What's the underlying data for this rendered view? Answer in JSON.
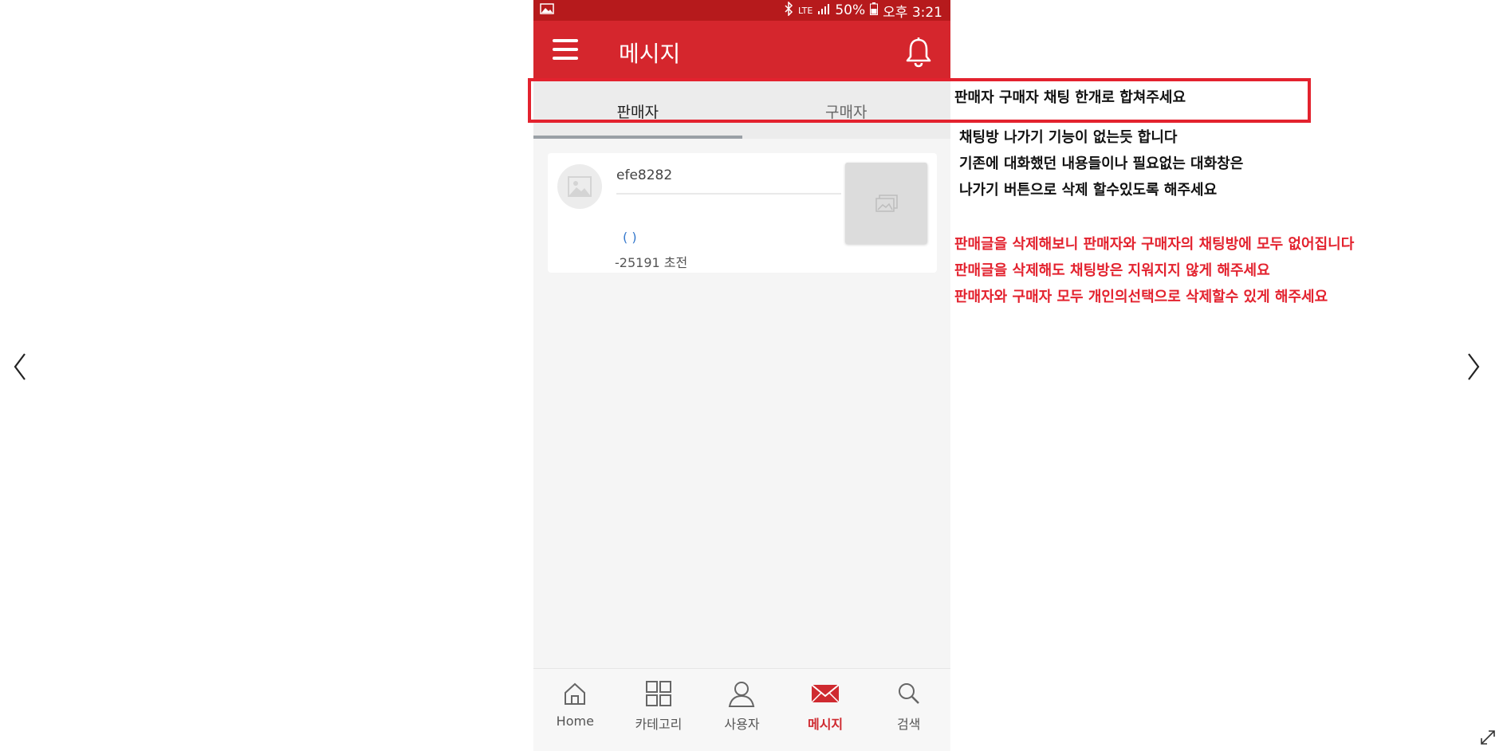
{
  "status_bar": {
    "network": "LTE",
    "battery": "50%",
    "time": "오후 3:21"
  },
  "app_bar": {
    "title": "메시지",
    "menu_icon": "hamburger-menu-icon",
    "notification_icon": "bell-icon"
  },
  "tabs": [
    {
      "label": "판매자",
      "active": true
    },
    {
      "label": "구매자",
      "active": false
    }
  ],
  "chats": [
    {
      "name": "efe8282",
      "preview": "( )",
      "time": "-25191 초전"
    }
  ],
  "bottom_nav": [
    {
      "label": "Home",
      "icon": "home-icon",
      "active": false
    },
    {
      "label": "카테고리",
      "icon": "grid-icon",
      "active": false
    },
    {
      "label": "사용자",
      "icon": "user-icon",
      "active": false
    },
    {
      "label": "메시지",
      "icon": "envelope-icon",
      "active": true
    },
    {
      "label": "검색",
      "icon": "search-icon",
      "active": false
    }
  ],
  "annotations": {
    "box_note": "판매자 구매자 채팅 한개로 합쳐주세요",
    "black_notes": [
      "채팅방 나가기 기능이 없는듯 합니다",
      "기존에 대화했던 내용들이나 필요없는 대화창은",
      "나가기 버튼으로 삭제 할수있도록 해주세요"
    ],
    "red_notes": [
      "판매글을 삭제해보니 판매자와 구매자의 채팅방에 모두 없어집니다",
      "판매글을 삭제해도 채팅방은 지워지지 않게 해주세요",
      "판매자와 구매자 모두 개인의선택으로 삭제할수 있게 해주세요"
    ]
  },
  "colors": {
    "app_bar": "#d5262d",
    "status_bar": "#b61a1c",
    "accent_red": "#e3222e"
  }
}
